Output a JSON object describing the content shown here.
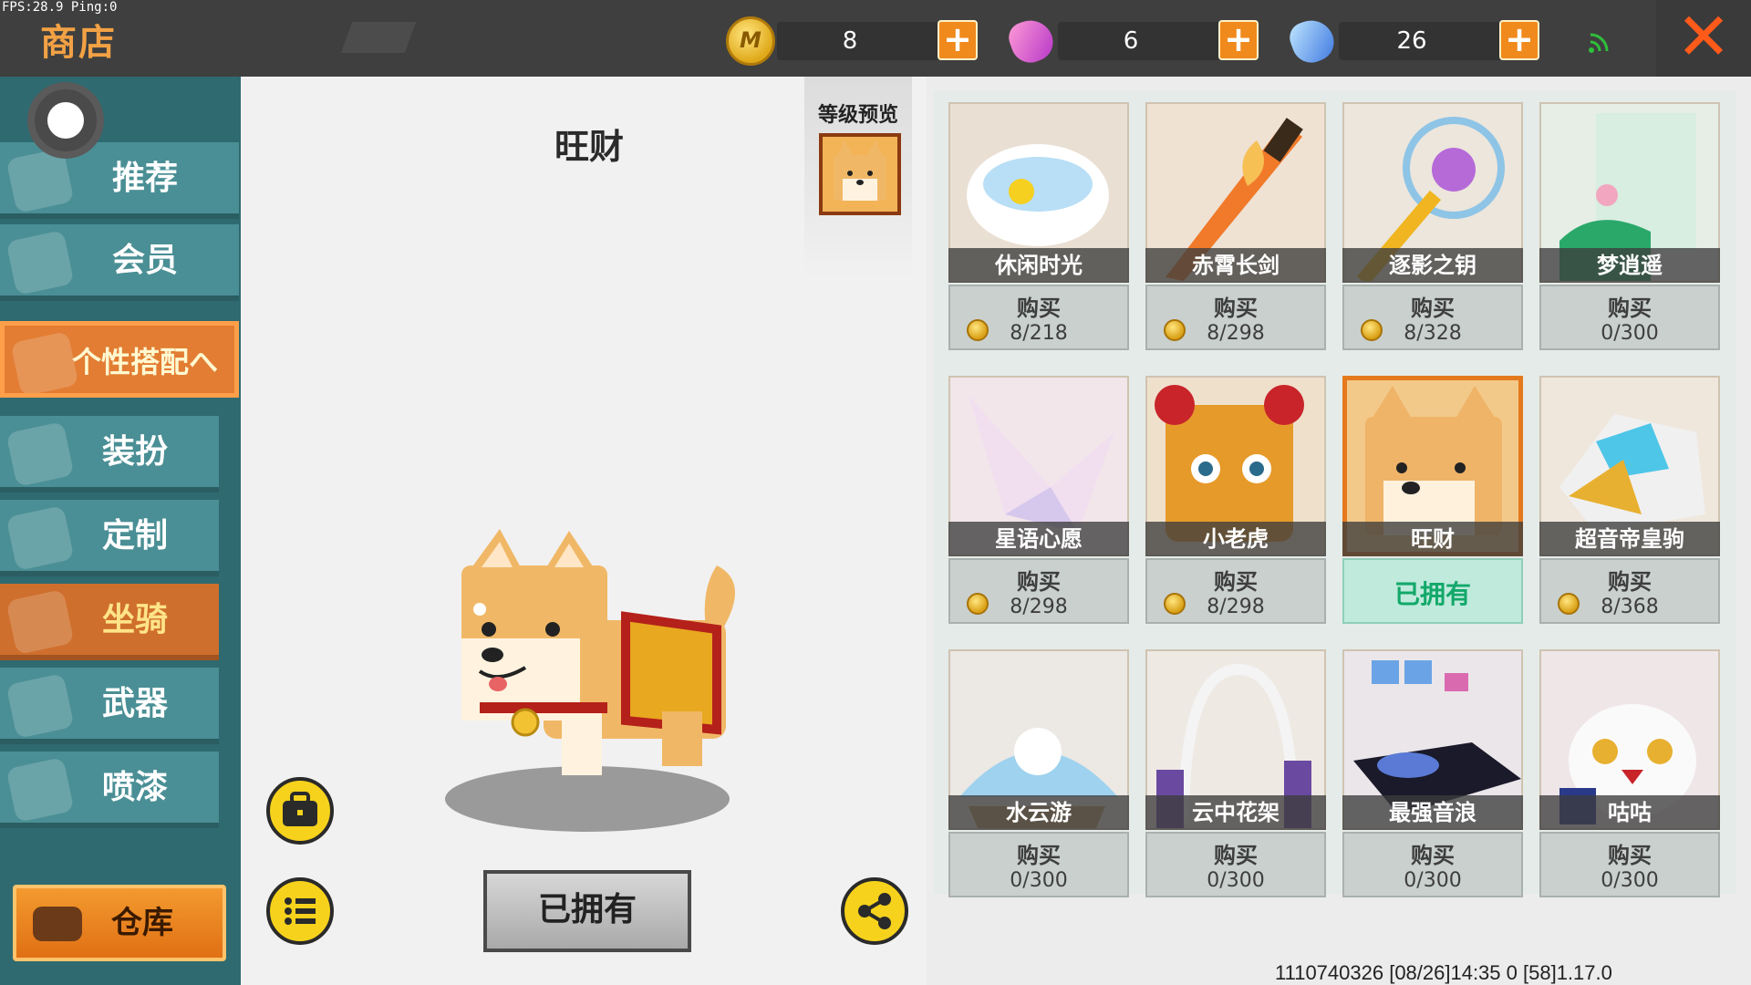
{
  "debug": {
    "fps": "FPS:28.9  Ping:0"
  },
  "header": {
    "title": "商店",
    "currencies": [
      {
        "icon": "mini-coin-icon",
        "coin_letter": "M",
        "value": "8"
      },
      {
        "icon": "pink-gem-icon",
        "value": "6"
      },
      {
        "icon": "blue-gem-icon",
        "value": "26"
      }
    ],
    "close": "✕"
  },
  "sidebar": {
    "items": [
      {
        "label": "推荐"
      },
      {
        "label": "会员"
      },
      {
        "label": "个性搭配へ"
      },
      {
        "label": "装扮"
      },
      {
        "label": "定制"
      },
      {
        "label": "坐骑"
      },
      {
        "label": "武器"
      },
      {
        "label": "喷漆"
      }
    ],
    "warehouse": "仓库"
  },
  "preview": {
    "name": "旺财",
    "level_preview": "等级预览",
    "owned_button": "已拥有"
  },
  "items": [
    {
      "name": "休闲时光",
      "buy": "购买",
      "price": "8/218",
      "coin": true
    },
    {
      "name": "赤霄长剑",
      "buy": "购买",
      "price": "8/298",
      "coin": true
    },
    {
      "name": "逐影之钥",
      "buy": "购买",
      "price": "8/328",
      "coin": true
    },
    {
      "name": "梦逍遥",
      "buy": "购买",
      "price": "0/300",
      "coin": false
    },
    {
      "name": "星语心愿",
      "buy": "购买",
      "price": "8/298",
      "coin": true
    },
    {
      "name": "小老虎",
      "buy": "购买",
      "price": "8/298",
      "coin": true
    },
    {
      "name": "旺财",
      "owned": "已拥有"
    },
    {
      "name": "超音帝皇驹",
      "buy": "购买",
      "price": "8/368",
      "coin": true
    },
    {
      "name": "水云游",
      "buy": "购买",
      "price": "0/300",
      "coin": false
    },
    {
      "name": "云中花架",
      "buy": "购买",
      "price": "0/300",
      "coin": false
    },
    {
      "name": "最强音浪",
      "buy": "购买",
      "price": "0/300",
      "coin": false
    },
    {
      "name": "咕咕",
      "buy": "购买",
      "price": "0/300",
      "coin": false
    }
  ],
  "footer": {
    "text": "1110740326    [08/26]14:35 0 [58]1.17.0"
  },
  "colors": {
    "accent_orange": "#e47a1d",
    "sidebar_teal": "#4a8f95",
    "owned_green": "#12a86a"
  }
}
